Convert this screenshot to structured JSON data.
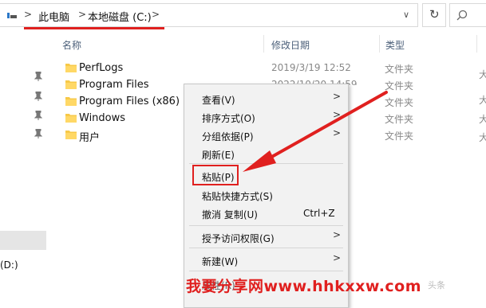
{
  "address_bar": {
    "crumbs": [
      "此电脑",
      "本地磁盘 (C:)"
    ],
    "separator": ">",
    "dropdown_glyph": "∨",
    "refresh_glyph": "↻"
  },
  "columns": {
    "name": "名称",
    "date": "修改日期",
    "type": "类型"
  },
  "files": [
    {
      "name": "PerfLogs",
      "date": "2019/3/19 12:52",
      "type": "文件夹"
    },
    {
      "name": "Program Files",
      "date": "2022/10/20 14:59",
      "type": "文件夹"
    },
    {
      "name": "Program Files (x86)",
      "date": "",
      "type": "文件夹"
    },
    {
      "name": "Windows",
      "date": "",
      "type": "文件夹"
    },
    {
      "name": "用户",
      "date": "",
      "type": "文件夹"
    }
  ],
  "side_fragment": "大",
  "nav": {
    "drive_label": "(D:)"
  },
  "context_menu": {
    "items": [
      {
        "label": "查看(V)",
        "submenu": true
      },
      {
        "label": "排序方式(O)",
        "submenu": true
      },
      {
        "label": "分组依据(P)",
        "submenu": true
      },
      {
        "label": "刷新(E)",
        "submenu": false
      },
      {
        "label": "粘贴(P)",
        "submenu": false
      },
      {
        "label": "粘贴快捷方式(S)",
        "submenu": false
      },
      {
        "label": "撤消 复制(U)",
        "shortcut": "Ctrl+Z",
        "submenu": false
      },
      {
        "label": "授予访问权限(G)",
        "submenu": true
      },
      {
        "label": "新建(W)",
        "submenu": true
      },
      {
        "label": "属性(R)",
        "submenu": false
      }
    ],
    "arrow_glyph": ">"
  },
  "watermark": {
    "text": "我要分享网www.hhkxxw.com",
    "faint_text": "头条"
  },
  "colors": {
    "accent_red": "#e0201f",
    "folder_yellow": "#f7c948"
  }
}
